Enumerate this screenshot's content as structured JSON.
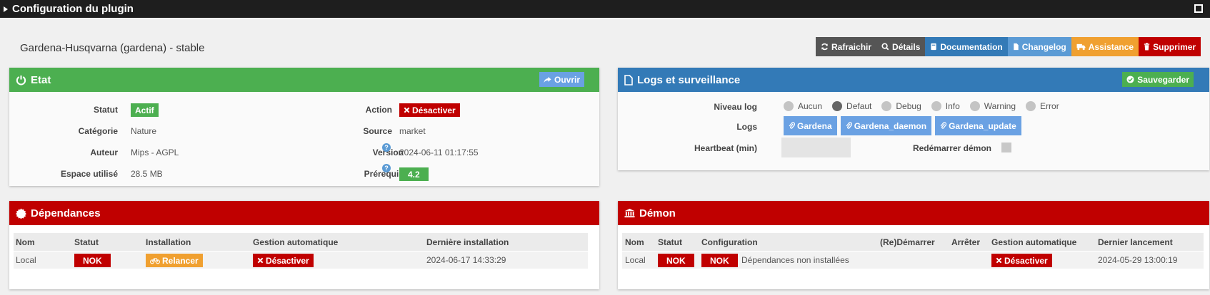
{
  "window": {
    "title": "Configuration du plugin"
  },
  "plugin": {
    "title": "Gardena-Husqvarna (gardena) - stable"
  },
  "toolbar": {
    "refresh": "Rafraichir",
    "details": "Détails",
    "documentation": "Documentation",
    "changelog": "Changelog",
    "assistance": "Assistance",
    "delete": "Supprimer"
  },
  "etat": {
    "title": "Etat",
    "open_label": "Ouvrir",
    "statut_label": "Statut",
    "statut_value": "Actif",
    "categorie_label": "Catégorie",
    "categorie_value": "Nature",
    "auteur_label": "Auteur",
    "auteur_value": "Mips - AGPL",
    "espace_label": "Espace utilisé",
    "espace_value": "28.5 MB",
    "action_label": "Action",
    "action_value": "Désactiver",
    "source_label": "Source",
    "source_value": "market",
    "version_label": "Version",
    "version_value": "2024-06-11 01:17:55",
    "prerequis_label": "Prérequis",
    "prerequis_value": "4.2"
  },
  "logs": {
    "title": "Logs et surveillance",
    "save_label": "Sauvegarder",
    "niveau_label": "Niveau log",
    "levels": [
      "Aucun",
      "Defaut",
      "Debug",
      "Info",
      "Warning",
      "Error"
    ],
    "selected_level": "Defaut",
    "logs_label": "Logs",
    "log_buttons": [
      "Gardena",
      "Gardena_daemon",
      "Gardena_update"
    ],
    "heartbeat_label": "Heartbeat (min)",
    "heartbeat_value": "",
    "restart_label": "Redémarrer démon"
  },
  "dependances": {
    "title": "Dépendances",
    "headers": [
      "Nom",
      "Statut",
      "Installation",
      "Gestion automatique",
      "Dernière installation"
    ],
    "row": {
      "nom": "Local",
      "statut": "NOK",
      "installation": "Relancer",
      "gestion": "Désactiver",
      "derniere": "2024-06-17 14:33:29"
    }
  },
  "demon": {
    "title": "Démon",
    "headers": [
      "Nom",
      "Statut",
      "Configuration",
      "(Re)Démarrer",
      "Arrêter",
      "Gestion automatique",
      "Dernier lancement"
    ],
    "row": {
      "nom": "Local",
      "statut": "NOK",
      "config_badge": "NOK",
      "config_text": "Dépendances non installées",
      "gestion": "Désactiver",
      "dernier": "2024-05-29 13:00:19"
    }
  },
  "colors": {
    "green": "#4caf50",
    "blue": "#337ab7",
    "red": "#c00000",
    "orange": "#f0a030"
  }
}
